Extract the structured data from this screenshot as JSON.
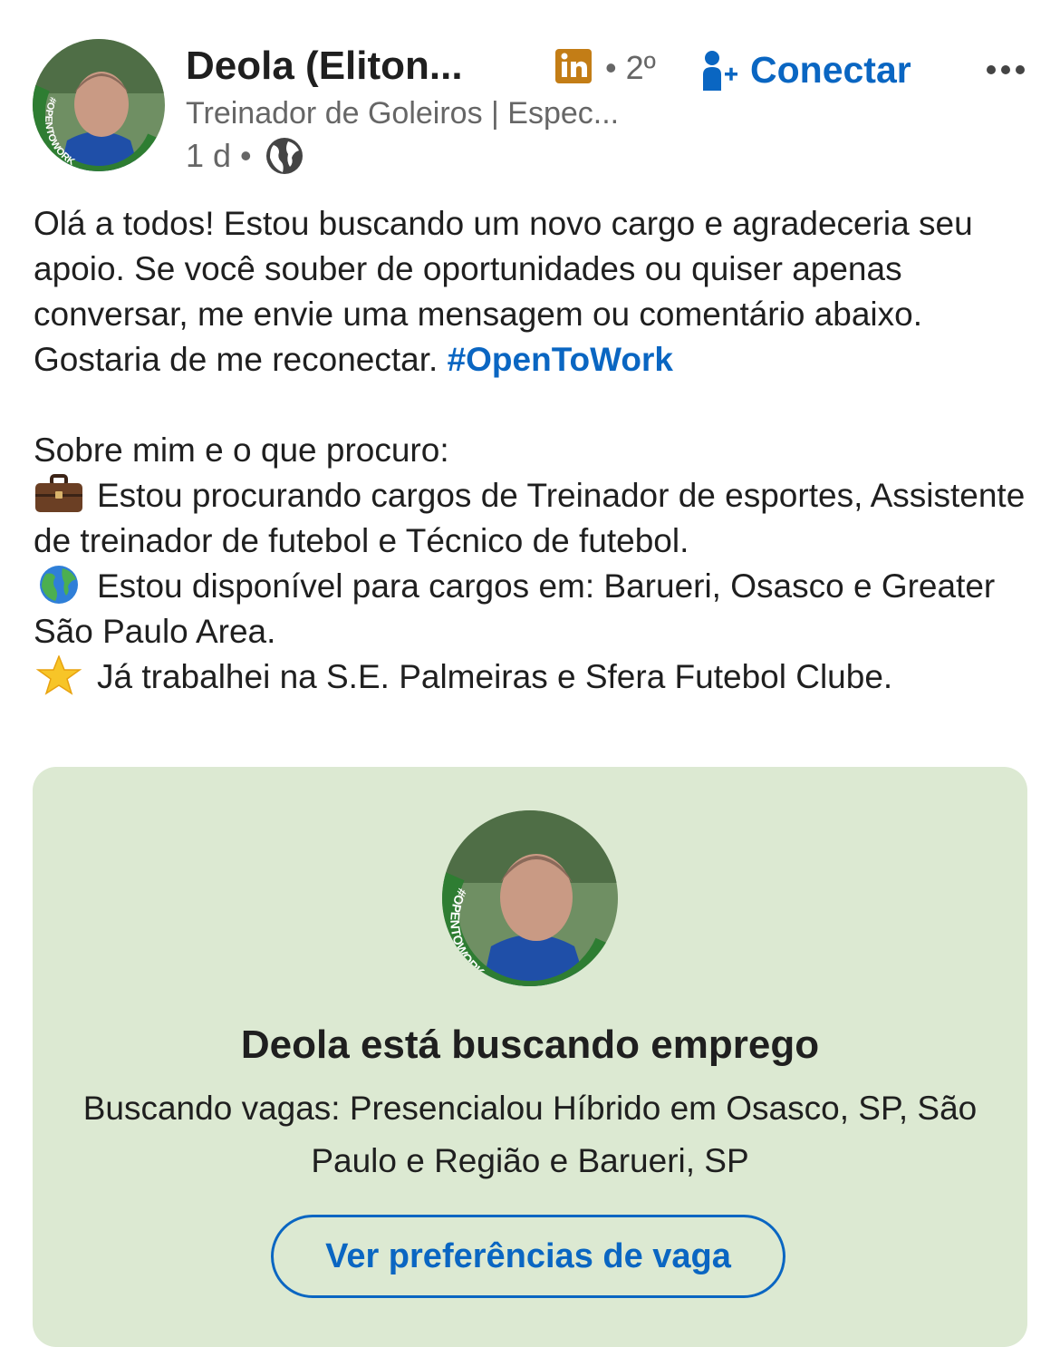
{
  "author": {
    "name": "Deola (Eliton...",
    "degree": "• 2º",
    "headline": "Treinador de Goleiros | Espec...",
    "time": "1 d •",
    "avatar_badge": "#OPENTOWORK"
  },
  "actions": {
    "connect_label": "Conectar"
  },
  "post": {
    "intro": "Olá a todos! Estou buscando um novo cargo e agradeceria seu apoio. Se você souber de oportunidades ou quiser apenas conversar, me envie uma mensagem ou comentário abaixo. Gostaria de me reconectar. ",
    "hashtag": "#OpenToWork",
    "about_heading": "Sobre mim e o que procuro:",
    "line_roles": "Estou procurando cargos de Treinador de esportes, Assistente de treinador de futebol e Técnico de futebol.",
    "line_locations": "Estou disponível para cargos em: Barueri, Osasco e Greater São Paulo Area.",
    "line_experience": "Já trabalhei na S.E. Palmeiras e Sfera Futebol Clube."
  },
  "open_to_work_card": {
    "badge": "#OPENTOWORK",
    "title": "Deola está buscando emprego",
    "description": "Buscando vagas: Presencialou Híbrido em Osasco, SP, São Paulo e Região e Barueri, SP",
    "button_label": "Ver preferências de vaga"
  },
  "icons": {
    "linkedin": "linkedin-premium-icon",
    "connect": "add-person-icon",
    "more": "more-options-icon",
    "visibility": "globe-icon",
    "roles": "briefcase-emoji",
    "locations": "globe-emoji",
    "experience": "star-emoji"
  },
  "colors": {
    "accent": "#0a66c2",
    "card_bg": "#dce9d2",
    "badge_green": "#2e7d32",
    "premium_gold": "#c37d16"
  }
}
